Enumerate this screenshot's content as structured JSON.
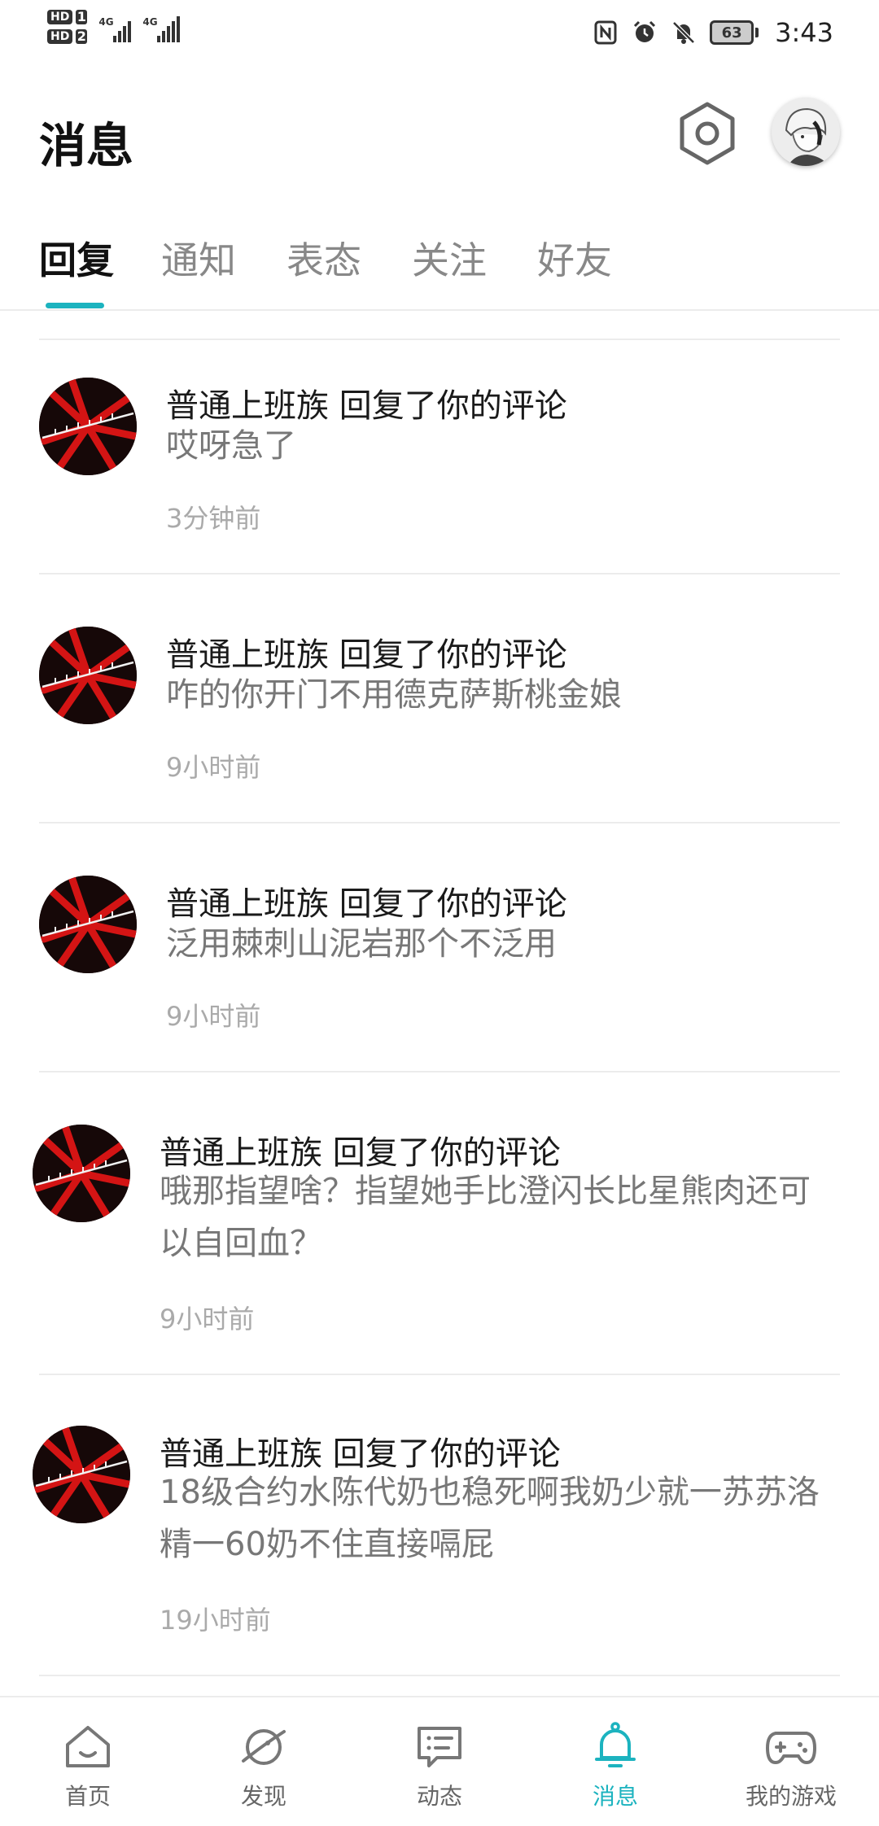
{
  "status_bar": {
    "sim1_label": "HD",
    "sim1_num": "1",
    "sim2_label": "HD",
    "sim2_num": "2",
    "network1": "4G",
    "network2": "4G",
    "battery_level": "63",
    "time": "3:43",
    "icons": [
      "nfc-icon",
      "alarm-icon",
      "mute-bell-icon"
    ]
  },
  "header": {
    "title": "消息",
    "settings_icon": "hexagon-settings-icon",
    "avatar": "user-avatar"
  },
  "tabs": [
    {
      "label": "回复",
      "active": true
    },
    {
      "label": "通知",
      "active": false
    },
    {
      "label": "表态",
      "active": false
    },
    {
      "label": "关注",
      "active": false
    },
    {
      "label": "好友",
      "active": false
    }
  ],
  "accent_color": "#1cb3bf",
  "messages": [
    {
      "title": "普通上班族 回复了你的评论",
      "content": "哎呀急了",
      "time": "3分钟前"
    },
    {
      "title": "普通上班族 回复了你的评论",
      "content": "咋的你开门不用德克萨斯桃金娘",
      "time": "9小时前"
    },
    {
      "title": "普通上班族 回复了你的评论",
      "content": "泛用棘刺山泥岩那个不泛用",
      "time": "9小时前"
    },
    {
      "title": "普通上班族 回复了你的评论",
      "content": "哦那指望啥？指望她手比澄闪长比星熊肉还可以自回血？",
      "time": "9小时前"
    },
    {
      "title": "普通上班族 回复了你的评论",
      "content": "18级合约水陈代奶也稳死啊我奶少就一苏苏洛精一60奶不住直接嗝屁",
      "time": "19小时前"
    }
  ],
  "bottom_nav": [
    {
      "label": "首页",
      "icon": "home-icon",
      "active": false
    },
    {
      "label": "发现",
      "icon": "planet-icon",
      "active": false
    },
    {
      "label": "动态",
      "icon": "chat-card-icon",
      "active": false
    },
    {
      "label": "消息",
      "icon": "bell-icon",
      "active": true
    },
    {
      "label": "我的游戏",
      "icon": "gamepad-icon",
      "active": false
    }
  ]
}
